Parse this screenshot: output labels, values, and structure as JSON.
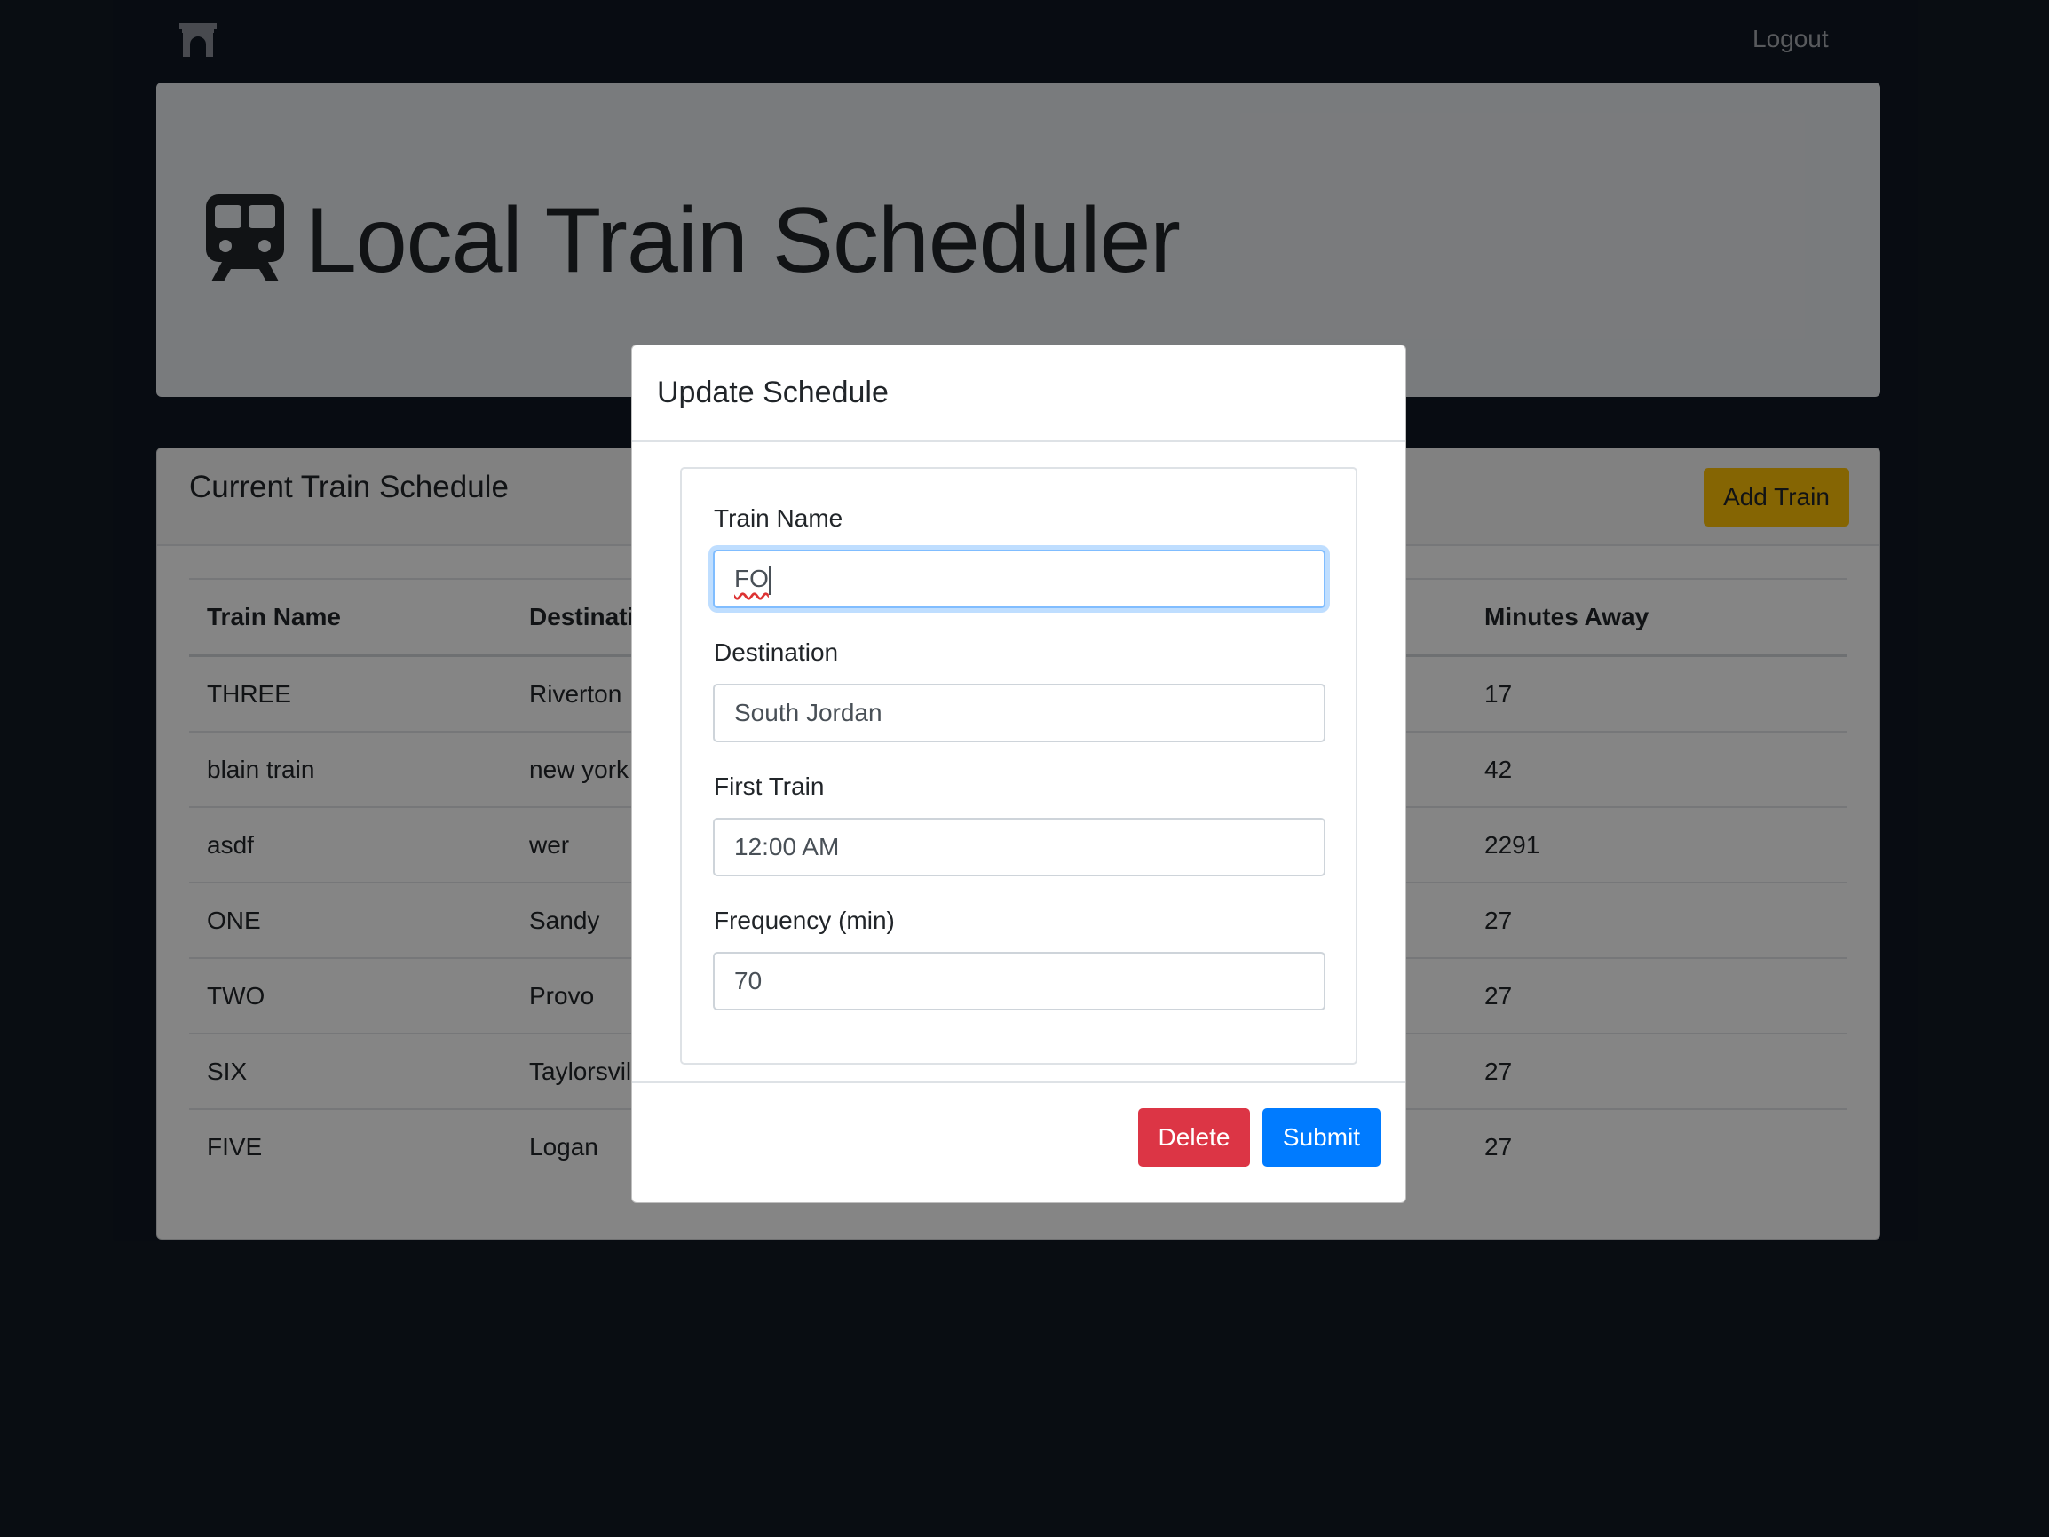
{
  "navbar": {
    "brand_icon": "archway-icon",
    "logout_label": "Logout"
  },
  "jumbotron": {
    "icon": "subway-icon",
    "title": "Local Train Scheduler"
  },
  "schedule": {
    "title": "Current Train Schedule",
    "add_button": "Add Train",
    "columns": [
      "Train Name",
      "Destinati",
      "Minutes Away"
    ],
    "rows": [
      {
        "name": "THREE",
        "destination": "Riverton",
        "minutes": "17"
      },
      {
        "name": "blain train",
        "destination": "new york",
        "minutes": "42"
      },
      {
        "name": "asdf",
        "destination": "wer",
        "minutes": "2291"
      },
      {
        "name": "ONE",
        "destination": "Sandy",
        "minutes": "27"
      },
      {
        "name": "TWO",
        "destination": "Provo",
        "minutes": "27"
      },
      {
        "name": "SIX",
        "destination": "Taylorsvill",
        "minutes": "27"
      },
      {
        "name": "FIVE",
        "destination": "Logan",
        "minutes": "27"
      }
    ]
  },
  "modal": {
    "title": "Update Schedule",
    "fields": {
      "train_name": {
        "label": "Train Name",
        "value": "FO"
      },
      "destination": {
        "label": "Destination",
        "value": "South Jordan"
      },
      "first_train": {
        "label": "First Train",
        "value": "12:00 AM"
      },
      "frequency": {
        "label": "Frequency (min)",
        "value": "70"
      }
    },
    "delete_label": "Delete",
    "submit_label": "Submit"
  },
  "colors": {
    "background": "#111823",
    "jumbotron": "#e9ecef",
    "warning": "#ffc107",
    "danger": "#dc3545",
    "primary": "#007bff",
    "focus_ring": "#80bdff"
  }
}
